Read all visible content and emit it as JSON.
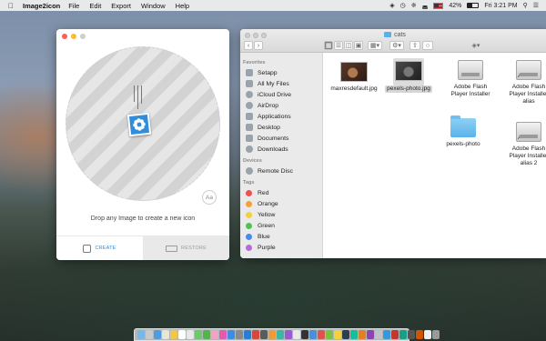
{
  "menubar": {
    "app_name": "Image2icon",
    "items": [
      "File",
      "Edit",
      "Export",
      "Window",
      "Help"
    ],
    "battery_percent": "42%",
    "clock": "Fri 3:21 PM",
    "status_icons": [
      "dropbox-icon",
      "timemachine-icon",
      "bluetooth-icon",
      "wifi-icon",
      "flag-icon",
      "battery-icon",
      "search-icon",
      "list-icon"
    ]
  },
  "image2icon": {
    "caption": "Drop any Image to create a new icon",
    "font_button": "Aa",
    "tabs": [
      {
        "label": "CREATE",
        "active": true
      },
      {
        "label": "RESTORE",
        "active": false
      }
    ],
    "accent": "#2f8ddb"
  },
  "finder": {
    "title": "cats",
    "sidebar": {
      "favorites_header": "Favorites",
      "favorites": [
        "Setapp",
        "All My Files",
        "iCloud Drive",
        "AirDrop",
        "Applications",
        "Desktop",
        "Documents",
        "Downloads"
      ],
      "devices_header": "Devices",
      "devices": [
        "Remote Disc"
      ],
      "tags_header": "Tags",
      "tags": [
        {
          "label": "Red",
          "color": "#f24f4f"
        },
        {
          "label": "Orange",
          "color": "#f5a23a"
        },
        {
          "label": "Yellow",
          "color": "#f1d13c"
        },
        {
          "label": "Green",
          "color": "#4fc24f"
        },
        {
          "label": "Blue",
          "color": "#3f8ef0"
        },
        {
          "label": "Purple",
          "color": "#b26ed6"
        }
      ]
    },
    "files": [
      {
        "name": "maxresdefault.jpg",
        "kind": "photo"
      },
      {
        "name": "pexels-photo.jpg",
        "kind": "photo",
        "selected": true
      },
      {
        "name": "Adobe Flash Player Installer",
        "kind": "disk"
      },
      {
        "name": "Adobe Flash Player Installer alias",
        "kind": "disk"
      },
      {
        "name": "pexels-photo",
        "kind": "folder"
      },
      {
        "name": "Adobe Flash Player Installer alias 2",
        "kind": "disk"
      }
    ]
  }
}
